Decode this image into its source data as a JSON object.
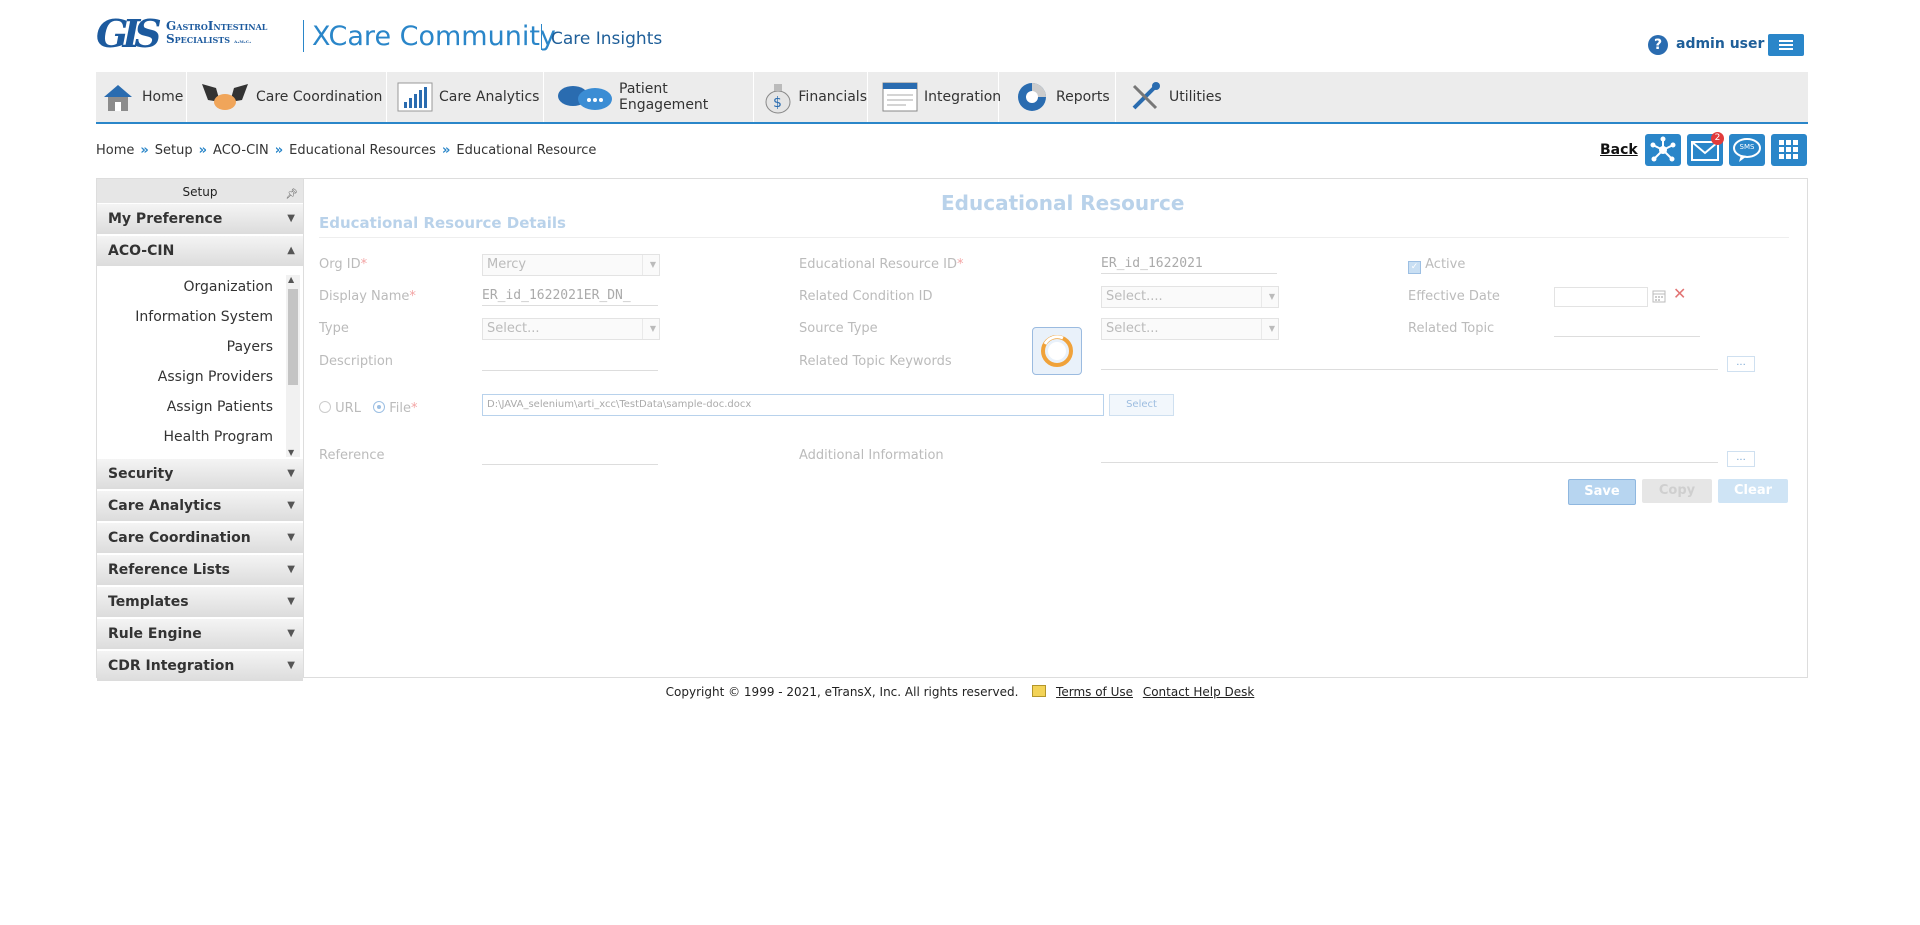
{
  "header": {
    "logo_mark": "GIS",
    "logo_line1": "GastroIntestinal",
    "logo_line2": "Specialists",
    "logo_suffix": "a.m.c.",
    "app_title": "XCare Community",
    "app_subtitle": "Care Insights",
    "user_name": "admin user"
  },
  "nav": [
    {
      "label": "Home",
      "icon": "home-icon"
    },
    {
      "label": "Care Coordination",
      "icon": "handshake-icon"
    },
    {
      "label": "Care Analytics",
      "icon": "bar-chart-icon"
    },
    {
      "label": "Patient Engagement",
      "icon": "chat-cloud-icon"
    },
    {
      "label": "Financials",
      "icon": "money-bag-icon"
    },
    {
      "label": "Integration",
      "icon": "window-icon"
    },
    {
      "label": "Reports",
      "icon": "pie-chart-icon"
    },
    {
      "label": "Utilities",
      "icon": "tools-icon"
    }
  ],
  "breadcrumb": [
    "Home",
    "Setup",
    "ACO-CIN",
    "Educational Resources",
    "Educational Resource"
  ],
  "toolbar": {
    "back_label": "Back",
    "mail_badge": "2",
    "sms_label": "SMS"
  },
  "sidebar": {
    "title": "Setup",
    "sections": [
      "My Preference",
      "ACO-CIN",
      "Security",
      "Care Analytics",
      "Care Coordination",
      "Reference Lists",
      "Templates",
      "Rule Engine",
      "CDR Integration"
    ],
    "aco_items": [
      "Organization",
      "Information System",
      "Payers",
      "Assign Providers",
      "Assign Patients",
      "Health Program"
    ]
  },
  "form": {
    "page_title": "Educational Resource",
    "section_title": "Educational Resource Details",
    "org_id_label": "Org ID",
    "org_id_value": "Mercy",
    "display_name_label": "Display Name",
    "display_name_value": "ER_id_1622021ER_DN_",
    "type_label": "Type",
    "type_value": "Select...",
    "description_label": "Description",
    "edu_id_label": "Educational Resource ID",
    "edu_id_value": "ER_id_1622021",
    "related_condition_label": "Related Condition ID",
    "related_condition_value": "Select....",
    "source_type_label": "Source Type",
    "source_type_value": "Select...",
    "related_keywords_label": "Related Topic Keywords",
    "active_label": "Active",
    "effective_date_label": "Effective Date",
    "related_topic_label": "Related Topic",
    "url_label": "URL",
    "file_label": "File",
    "file_path": "D:\\JAVA_selenium\\arti_xcc\\TestData\\sample-doc.docx",
    "select_button": "Select",
    "reference_label": "Reference",
    "additional_info_label": "Additional Information",
    "ellipsis": "...",
    "required_mark": "*",
    "save_label": "Save",
    "copy_label": "Copy",
    "clear_label": "Clear"
  },
  "footer": {
    "copyright": "Copyright © 1999 - 2021, eTransX, Inc. All rights reserved.",
    "terms": "Terms of Use",
    "help": "Contact Help Desk"
  },
  "colors": {
    "accent": "#2a86c9",
    "brand": "#1c5a9e",
    "nav_bg": "#ececec"
  }
}
